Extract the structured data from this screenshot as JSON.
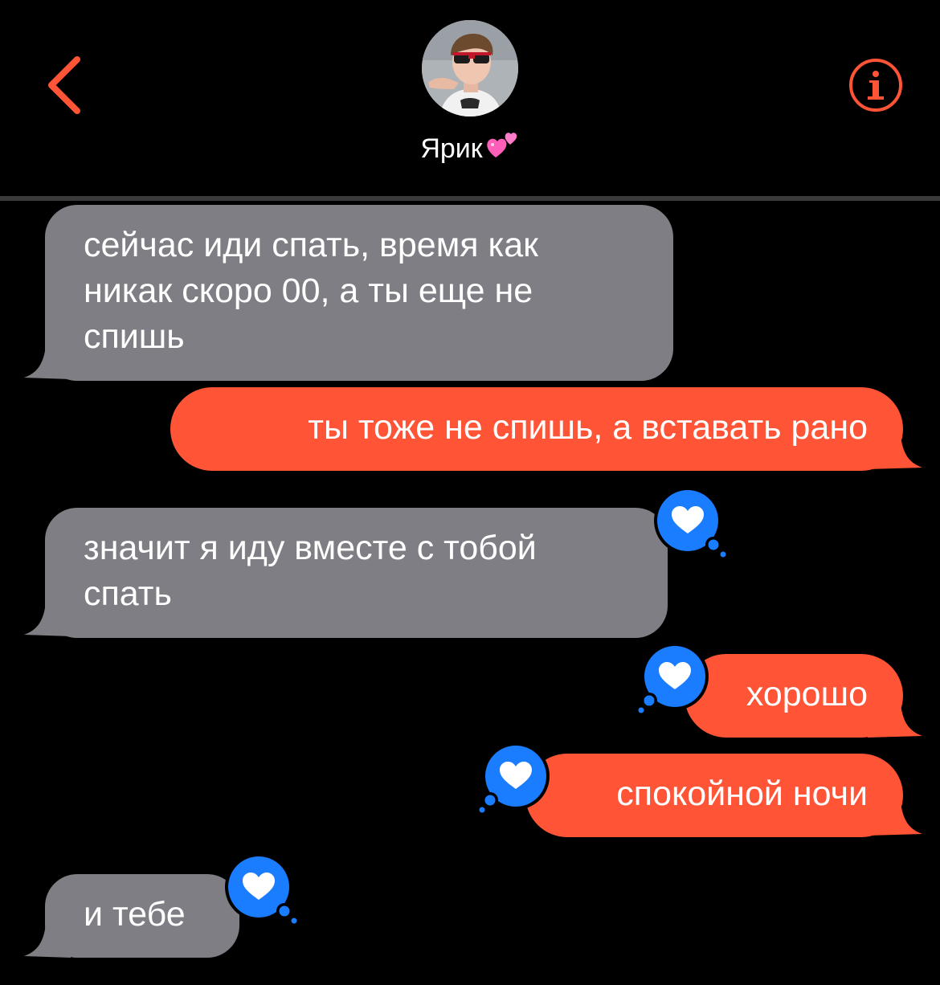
{
  "header": {
    "contact_name": "Ярик",
    "back_icon": "chevron-left-icon",
    "info_icon": "info-icon",
    "name_emoji": "two-hearts-emoji"
  },
  "colors": {
    "background": "#000000",
    "accent": "#ff5436",
    "incoming_bubble": "#7f7e84",
    "tapback": "#1a7cff"
  },
  "messages": [
    {
      "direction": "incoming",
      "lines": [
        "сейчас иди спать, время как",
        "никак скоро 00, а ты еще не",
        "спишь"
      ],
      "reaction": null
    },
    {
      "direction": "outgoing",
      "lines": [
        "ты тоже не спишь, а вставать рано"
      ],
      "reaction": null
    },
    {
      "direction": "incoming",
      "lines": [
        "значит я иду вместе с тобой",
        "спать"
      ],
      "reaction": "heart"
    },
    {
      "direction": "outgoing",
      "lines": [
        "хорошо"
      ],
      "reaction": "heart"
    },
    {
      "direction": "outgoing",
      "lines": [
        "спокойной ночи"
      ],
      "reaction": "heart"
    },
    {
      "direction": "incoming",
      "lines": [
        "и тебе"
      ],
      "reaction": "heart"
    }
  ]
}
